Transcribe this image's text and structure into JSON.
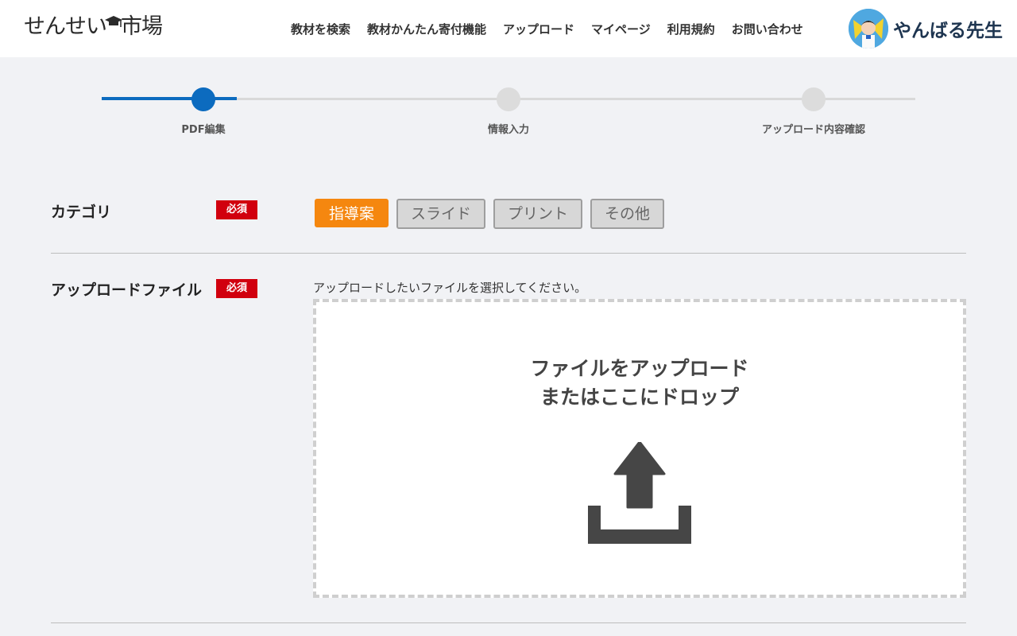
{
  "brand": {
    "logo_text_a": "せんせい",
    "logo_text_b": "市場"
  },
  "nav": [
    {
      "label": "教材を検索"
    },
    {
      "label": "教材かんたん寄付機能"
    },
    {
      "label": "アップロード"
    },
    {
      "label": "マイページ"
    },
    {
      "label": "利用規約"
    },
    {
      "label": "お問い合わせ"
    }
  ],
  "user": {
    "name": "やんばる先生",
    "avatar_icon": "user-avatar"
  },
  "stepper": {
    "steps": [
      {
        "label": "PDF編集",
        "active": true
      },
      {
        "label": "情報入力",
        "active": false
      },
      {
        "label": "アップロード内容確認",
        "active": false
      }
    ],
    "accent": "#0c6bbf"
  },
  "form": {
    "category": {
      "label": "カテゴリ",
      "required": "必須",
      "options": [
        {
          "label": "指導案",
          "selected": true
        },
        {
          "label": "スライド",
          "selected": false
        },
        {
          "label": "プリント",
          "selected": false
        },
        {
          "label": "その他",
          "selected": false
        }
      ]
    },
    "upload": {
      "label": "アップロードファイル",
      "required": "必須",
      "hint": "アップロードしたいファイルを選択してください。",
      "drop_line1": "ファイルをアップロード",
      "drop_line2": "またはここにドロップ",
      "icon": "upload-icon"
    }
  },
  "colors": {
    "required_badge": "#d1000e",
    "selected_option": "#f5870f"
  }
}
